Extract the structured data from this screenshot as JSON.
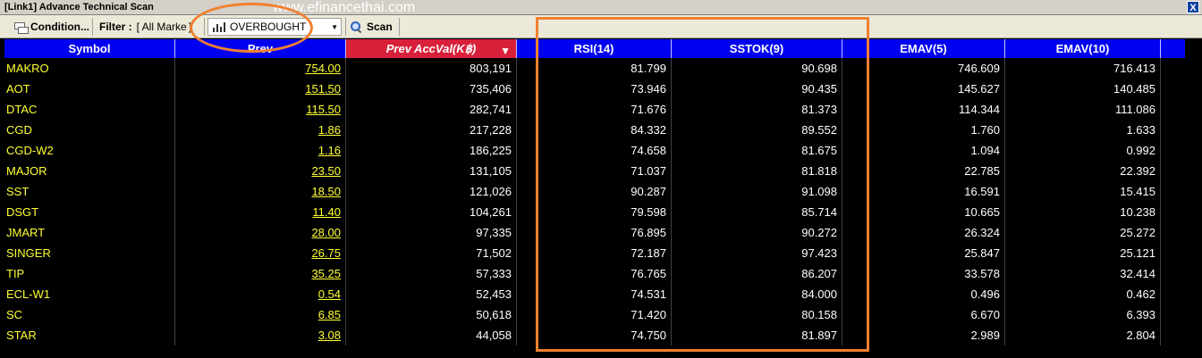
{
  "window": {
    "title": "[Link1] Advance Technical Scan",
    "watermark": "www.efinancethai.com",
    "close_label": "X"
  },
  "toolbar": {
    "condition_label": "Condition...",
    "filter_label": "Filter :",
    "filter_value": "[ All Marke",
    "filter_bracket": "]",
    "scan_type": "OVERBOUGHT",
    "scan_label": "Scan"
  },
  "table": {
    "columns": [
      "Symbol",
      "Prev",
      "Prev AccVal(K฿)",
      "RSI(14)",
      "SSTOK(9)",
      "EMAV(5)",
      "EMAV(10)"
    ],
    "sorted_arrow": "▼",
    "rows": [
      [
        "MAKRO",
        "754.00",
        "803,191",
        "81.799",
        "90.698",
        "746.609",
        "716.413"
      ],
      [
        "AOT",
        "151.50",
        "735,406",
        "73.946",
        "90.435",
        "145.627",
        "140.485"
      ],
      [
        "DTAC",
        "115.50",
        "282,741",
        "71.676",
        "81.373",
        "114.344",
        "111.086"
      ],
      [
        "CGD",
        "1.86",
        "217,228",
        "84.332",
        "89.552",
        "1.760",
        "1.633"
      ],
      [
        "CGD-W2",
        "1.16",
        "186,225",
        "74.658",
        "81.675",
        "1.094",
        "0.992"
      ],
      [
        "MAJOR",
        "23.50",
        "131,105",
        "71.037",
        "81.818",
        "22.785",
        "22.392"
      ],
      [
        "SST",
        "18.50",
        "121,026",
        "90.287",
        "91.098",
        "16.591",
        "15.415"
      ],
      [
        "DSGT",
        "11.40",
        "104,261",
        "79.598",
        "85.714",
        "10.665",
        "10.238"
      ],
      [
        "JMART",
        "28.00",
        "97,335",
        "76.895",
        "90.272",
        "26.324",
        "25.272"
      ],
      [
        "SINGER",
        "26.75",
        "71,502",
        "72.187",
        "97.423",
        "25.847",
        "25.121"
      ],
      [
        "TIP",
        "35.25",
        "57,333",
        "76.765",
        "86.207",
        "33.578",
        "32.414"
      ],
      [
        "ECL-W1",
        "0.54",
        "52,453",
        "74.531",
        "84.000",
        "0.496",
        "0.462"
      ],
      [
        "SC",
        "6.85",
        "50,618",
        "71.420",
        "80.158",
        "6.670",
        "6.393"
      ],
      [
        "STAR",
        "3.08",
        "44,058",
        "74.750",
        "81.897",
        "2.989",
        "2.804"
      ]
    ]
  },
  "colors": {
    "header_bg": "#0000f0",
    "sorted_header_bg": "#d8203a",
    "symbol_text": "#ffff33",
    "highlight": "#f08030"
  }
}
